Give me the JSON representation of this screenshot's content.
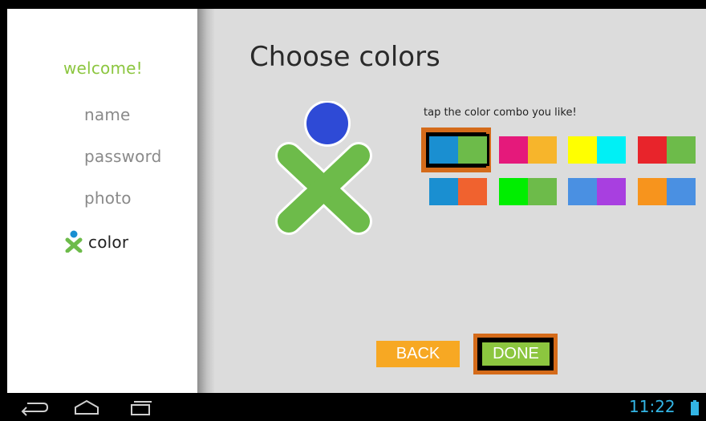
{
  "sidebar": {
    "welcome": "welcome!",
    "items": [
      {
        "label": "name"
      },
      {
        "label": "password"
      },
      {
        "label": "photo"
      },
      {
        "label": "color"
      }
    ]
  },
  "main": {
    "title": "Choose colors",
    "prompt": "tap the color combo you like!",
    "swatches": [
      {
        "left": "#1a8fd1",
        "right": "#6dbb4a",
        "selected": true
      },
      {
        "left": "#e5197b",
        "right": "#f7b52b"
      },
      {
        "left": "#ffff00",
        "right": "#00f0f5"
      },
      {
        "left": "#e8242b",
        "right": "#6dbb4a"
      },
      {
        "left": "#1a8fd1",
        "right": "#f0622f"
      },
      {
        "left": "#00ee00",
        "right": "#6dbb4a"
      },
      {
        "left": "#4a90e2",
        "right": "#a83fe0"
      },
      {
        "left": "#f7941d",
        "right": "#4a90e2"
      }
    ]
  },
  "buttons": {
    "back_label": "BACK",
    "done_label": "DONE"
  },
  "statusbar": {
    "clock": "11:22"
  },
  "colors": {
    "accent_green": "#8cc63f",
    "accent_orange": "#f7a823",
    "highlight_frame": "#d46b1a",
    "xo_stroke": "#6dbb4a",
    "xo_head": "#2e4ad6"
  },
  "icons": [
    "back-nav-icon",
    "home-nav-icon",
    "recent-apps-icon",
    "battery-icon",
    "xo-avatar-icon"
  ]
}
